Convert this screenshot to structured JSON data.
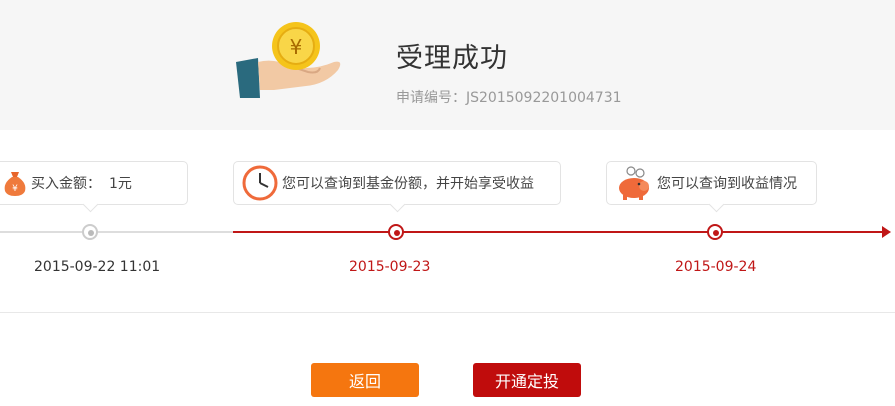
{
  "header": {
    "title": "受理成功",
    "order_label": "申请编号：",
    "order_number": "JS2015092201004731",
    "hand_icon": "hand-holding-yuan-coin-icon",
    "coin_symbol": "¥"
  },
  "timeline": {
    "steps": [
      {
        "label": "买入金额：",
        "value": "1元",
        "date": "2015-09-22 11:01",
        "icon": "money-bag-icon",
        "state": "done"
      },
      {
        "label": "您可以查询到基金份额，并开始享受收益",
        "date": "2015-09-23",
        "icon": "clock-icon",
        "state": "upcoming"
      },
      {
        "label": "您可以查询到收益情况",
        "date": "2015-09-24",
        "icon": "piggy-bank-icon",
        "state": "upcoming"
      }
    ],
    "colors": {
      "done": "#cccccc",
      "upcoming": "#c01717"
    }
  },
  "buttons": {
    "back": "返回",
    "open_plan": "开通定投"
  },
  "colors": {
    "back_button": "#f5760f",
    "plan_button": "#c00c0c"
  }
}
